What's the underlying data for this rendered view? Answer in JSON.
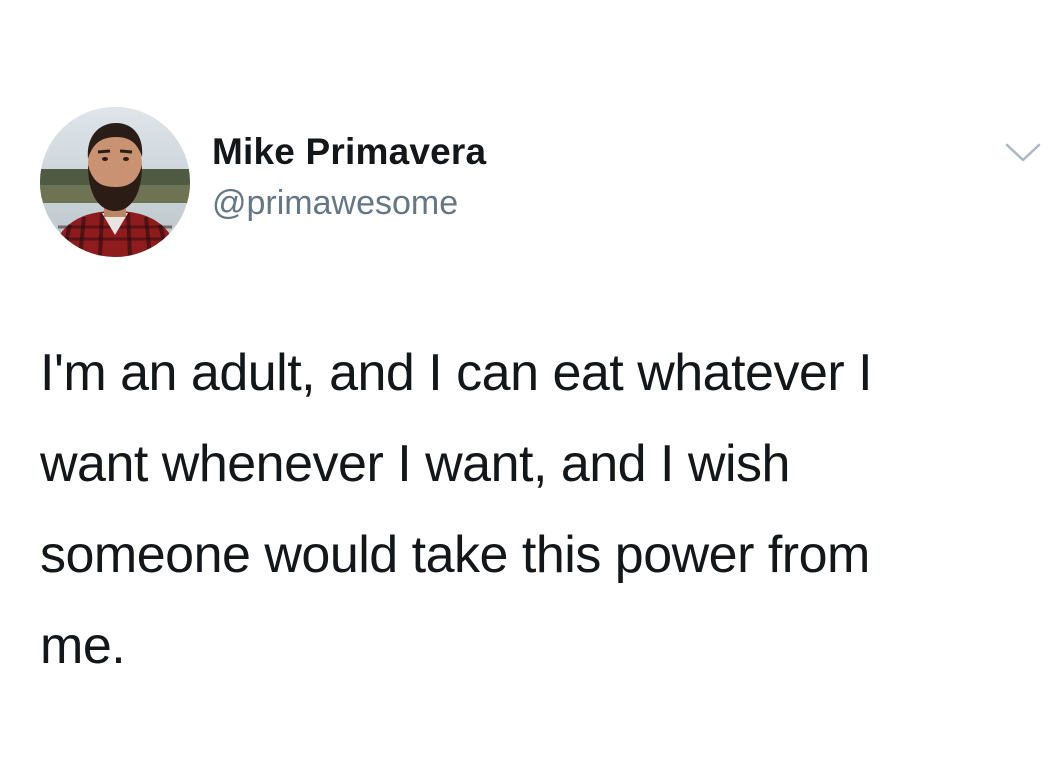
{
  "tweet": {
    "author": {
      "display_name": "Mike Primavera",
      "handle": "@primawesome",
      "avatar": "profile-photo"
    },
    "menu_icon": "chevron-down-icon",
    "text": "I'm an adult, and I can eat whatever I\nwant whenever I want, and I wish\nsomeone would take this power from\nme."
  },
  "colors": {
    "text": "#14171a",
    "secondary": "#657786",
    "background": "#ffffff"
  }
}
